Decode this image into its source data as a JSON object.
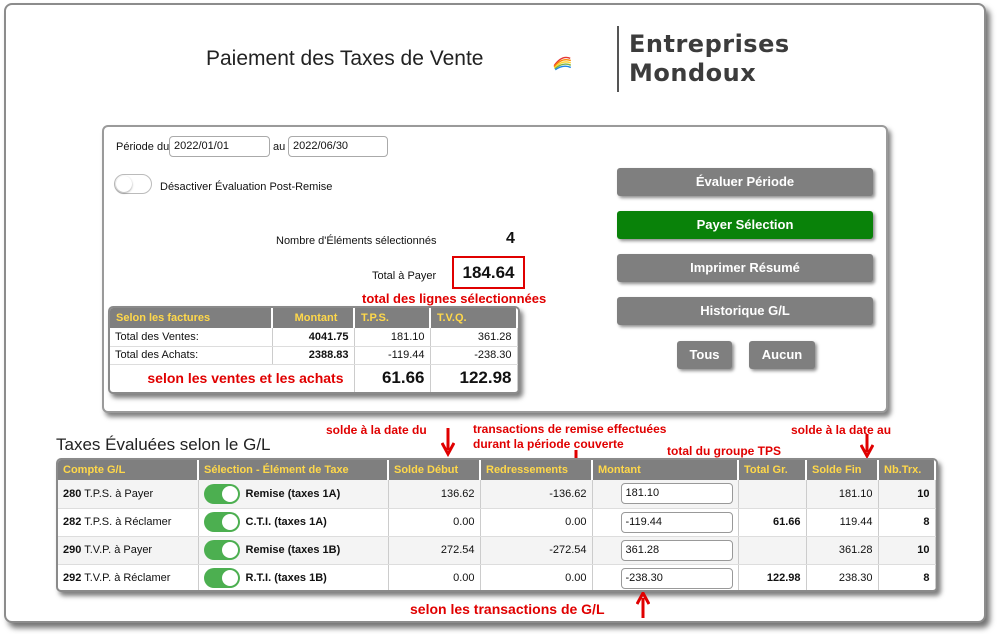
{
  "header": {
    "title": "Paiement des Taxes de Vente",
    "logo_line1": "Entreprises",
    "logo_line2": "Mondoux"
  },
  "period": {
    "label_from": "Période du",
    "from": "2022/01/01",
    "label_to": "au",
    "to": "2022/06/30"
  },
  "toggle_label": "Désactiver Évaluation Post-Remise",
  "selected_count_label": "Nombre d'Éléments sélectionnés",
  "selected_count": "4",
  "total_label": "Total à Payer",
  "total_value": "184.64",
  "annotations": {
    "total_lines": "total des lignes sélectionnées",
    "sales_purchases": "selon les ventes et les achats",
    "start_balance": "solde à la date du",
    "rebate_tx_1": "transactions de remise effectuées",
    "rebate_tx_2": "durant  la période couverte",
    "tps_group_total": "total du groupe TPS",
    "end_balance": "solde à la date au",
    "gl_tx": "selon les transactions de G/L"
  },
  "buttons": {
    "evaluate": "Évaluer Période",
    "pay": "Payer Sélection",
    "print": "Imprimer Résumé",
    "history": "Historique G/L",
    "all": "Tous",
    "none": "Aucun"
  },
  "colors": {
    "accent_green": "#098209",
    "header_gray": "#7f7f7f",
    "header_text": "#ffd84a",
    "annotation_red": "#e00000",
    "toggle_green": "#4caf50"
  },
  "summary": {
    "headers": [
      "Selon les factures",
      "Montant",
      "T.P.S.",
      "T.V.Q."
    ],
    "rows": [
      [
        "Total des Ventes:",
        "4041.75",
        "181.10",
        "361.28"
      ],
      [
        "Total des Achats:",
        "2388.83",
        "-119.44",
        "-238.30"
      ]
    ],
    "total_tps": "61.66",
    "total_tvq": "122.98"
  },
  "gl_section_title": "Taxes Évaluées selon le G/L",
  "gl": {
    "headers": [
      "Compte G/L",
      "Sélection - Élément de Taxe",
      "Solde Début",
      "Redressements",
      "Montant",
      "Total Gr.",
      "Solde Fin",
      "Nb.Trx."
    ],
    "rows": [
      {
        "account": "280",
        "account_name": "T.P.S. à Payer",
        "element": "Remise (taxes 1A)",
        "start": "136.62",
        "adjust": "-136.62",
        "amount": "181.10",
        "group_total": "",
        "end": "181.10",
        "ntrx": "10"
      },
      {
        "account": "282",
        "account_name": "T.P.S. à Réclamer",
        "element": "C.T.I. (taxes 1A)",
        "start": "0.00",
        "adjust": "0.00",
        "amount": "-119.44",
        "group_total": "61.66",
        "end": "119.44",
        "ntrx": "8"
      },
      {
        "account": "290",
        "account_name": "T.V.P. à Payer",
        "element": "Remise (taxes 1B)",
        "start": "272.54",
        "adjust": "-272.54",
        "amount": "361.28",
        "group_total": "",
        "end": "361.28",
        "ntrx": "10"
      },
      {
        "account": "292",
        "account_name": "T.V.P. à Réclamer",
        "element": "R.T.I. (taxes 1B)",
        "start": "0.00",
        "adjust": "0.00",
        "amount": "-238.30",
        "group_total": "122.98",
        "end": "238.30",
        "ntrx": "8"
      }
    ]
  }
}
